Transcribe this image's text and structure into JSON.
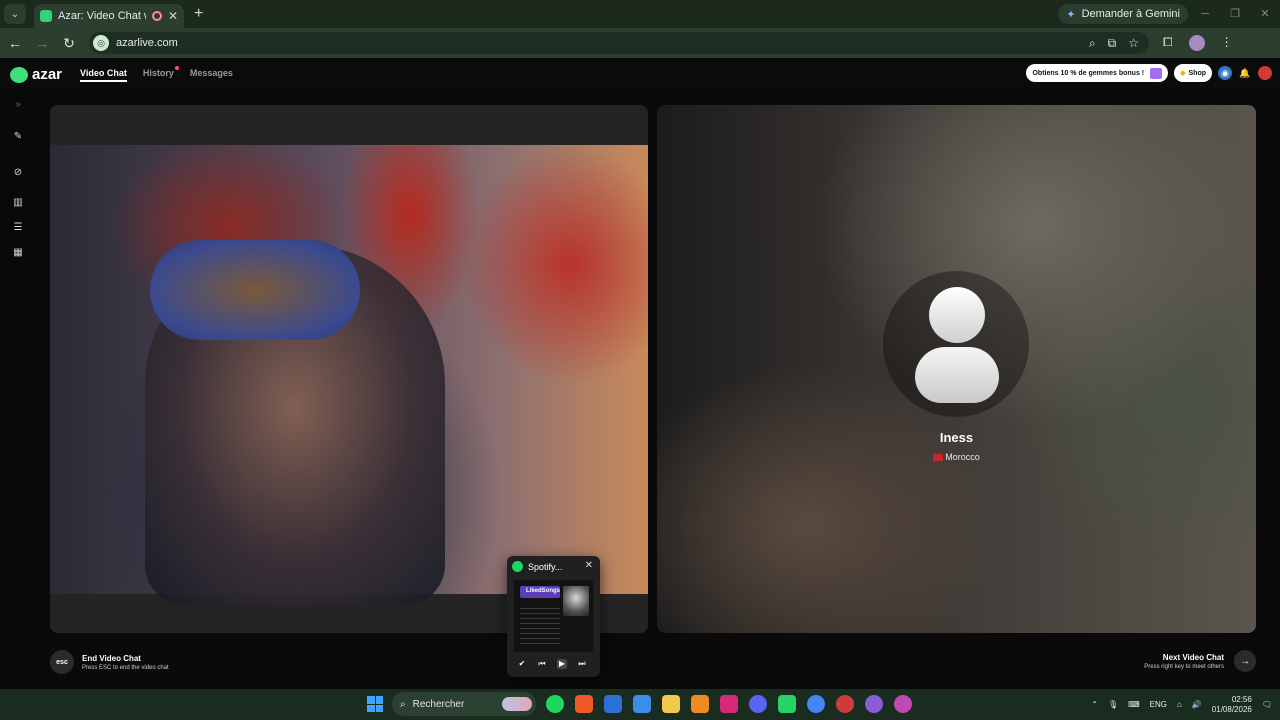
{
  "browser": {
    "tab_title": "Azar: Video Chat with New",
    "url": "azarlive.com",
    "gemini_label": "Demander à Gemini",
    "icons": [
      "tab-list-icon",
      "record-indicator-icon",
      "close-tab-icon",
      "new-tab-icon",
      "back-icon",
      "forward-icon",
      "reload-icon",
      "zoom-icon",
      "install-icon",
      "bookmark-star-icon",
      "extensions-icon",
      "profile-icon",
      "menu-icon"
    ]
  },
  "app": {
    "logo_text": "azar",
    "nav": {
      "video_chat": "Video Chat",
      "history": "History",
      "messages": "Messages"
    },
    "promo_text": "Obtiens 10 % de gemmes bonus !",
    "shop_label": "Shop"
  },
  "peer": {
    "name": "Iness",
    "country": "Morocco"
  },
  "controls": {
    "esc_key": "esc",
    "end_title": "End Video Chat",
    "end_sub": "Press ESC to end the video chat",
    "next_title": "Next Video Chat",
    "next_sub": "Press right key to meet others"
  },
  "spotify_popup": {
    "title": "Spotify...",
    "playlist_label": "LikedSongs"
  },
  "taskbar": {
    "search_placeholder": "Rechercher",
    "lang": "ENG",
    "time": "02:56",
    "date": "01/08/2026"
  },
  "colors": {
    "brand_green": "#3ee07a",
    "spotify_green": "#1ed760",
    "notification_red": "#ff4d6d"
  }
}
